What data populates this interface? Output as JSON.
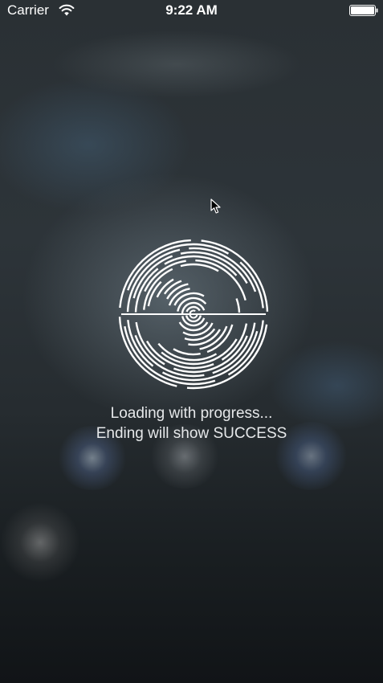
{
  "status_bar": {
    "carrier": "Carrier",
    "time": "9:22 AM",
    "wifi_icon": "wifi-icon",
    "battery_icon": "battery-icon",
    "battery_level": 1.0
  },
  "hud": {
    "spinner_icon": "concentric-arc-spinner-icon",
    "message_line_1": "Loading with progress...",
    "message_line_2": "Ending will show SUCCESS"
  },
  "colors": {
    "text": "#ffffff",
    "spinner": "#ffffff"
  }
}
